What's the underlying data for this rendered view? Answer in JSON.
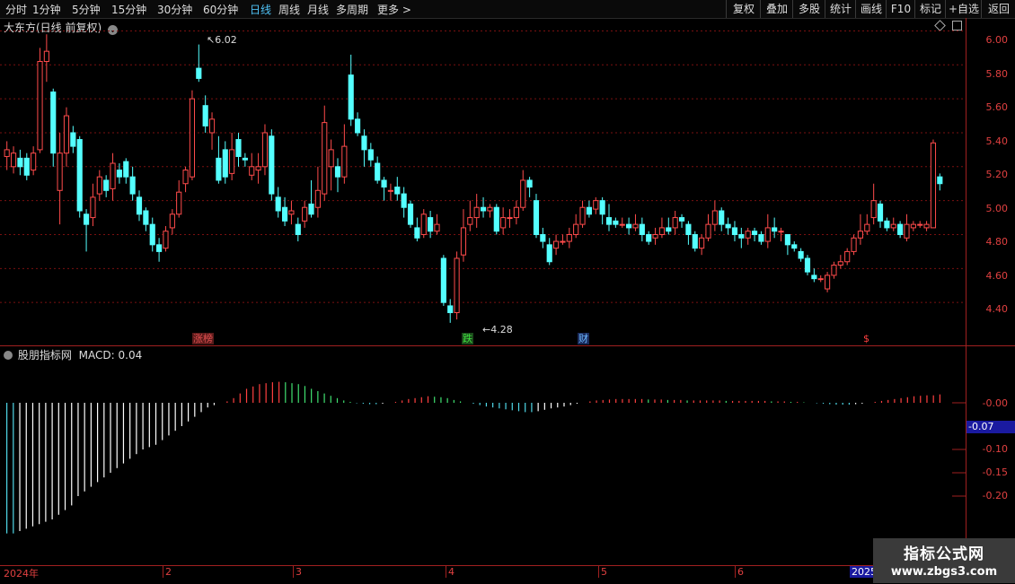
{
  "toolbar": {
    "timeframes": [
      "分时",
      "1分钟",
      "5分钟",
      "15分钟",
      "30分钟",
      "60分钟",
      "日线",
      "周线",
      "月线",
      "多周期",
      "更多 >"
    ],
    "active_timeframe": "日线",
    "right_buttons": [
      "复权",
      "叠加",
      "多股",
      "统计",
      "画线",
      "F10",
      "标记",
      "+自选",
      "返回"
    ]
  },
  "main_chart": {
    "title": "大东方(日线 前复权)",
    "y_ticks": [
      "6.00",
      "5.80",
      "5.60",
      "5.40",
      "5.20",
      "5.00",
      "4.80",
      "4.60",
      "4.40"
    ],
    "high_label": "6.02",
    "low_label": "4.28",
    "badges": [
      {
        "text": "涨榜",
        "color": "#e05050",
        "bg": "#5a1a1a"
      },
      {
        "text": "跌",
        "color": "#40e040",
        "bg": "#1a4a1a"
      },
      {
        "text": "财",
        "color": "#6bb8ff",
        "bg": "#1a2a5a"
      },
      {
        "text": "$",
        "color": "#ff4040",
        "bg": "#000000"
      }
    ]
  },
  "indicator": {
    "title": "股朋指标网",
    "macd_label": "MACD: 0.04",
    "y_ticks": [
      "-0.00",
      "-0.10",
      "-0.15",
      "-0.20"
    ],
    "current_value": "-0.07"
  },
  "date_axis": [
    "2024年",
    "2",
    "3",
    "4",
    "5",
    "6",
    "2025"
  ],
  "watermark": {
    "line1": "指标公式网",
    "line2": "www.zbgs3.com"
  },
  "chart_data": [
    {
      "type": "candlestick",
      "title": "大东方(日线 前复权)",
      "ylim": [
        4.2,
        6.05
      ],
      "candles": [
        [
          5.26,
          5.3,
          5.18,
          5.35
        ],
        [
          5.2,
          5.28,
          5.16,
          5.32
        ],
        [
          5.25,
          5.2,
          5.15,
          5.3
        ],
        [
          5.25,
          5.15,
          5.12,
          5.28
        ],
        [
          5.18,
          5.28,
          5.15,
          5.32
        ],
        [
          5.3,
          5.82,
          5.28,
          5.9
        ],
        [
          5.82,
          5.88,
          5.7,
          5.98
        ],
        [
          5.64,
          5.28,
          5.2,
          5.66
        ],
        [
          5.06,
          5.28,
          4.86,
          5.4
        ],
        [
          5.28,
          5.5,
          5.2,
          5.55
        ],
        [
          5.4,
          5.32,
          5.28,
          5.44
        ],
        [
          5.36,
          4.94,
          4.9,
          5.38
        ],
        [
          4.92,
          4.86,
          4.7,
          4.95
        ],
        [
          4.9,
          5.02,
          4.85,
          5.1
        ],
        [
          5.04,
          5.14,
          5.0,
          5.18
        ],
        [
          5.12,
          5.06,
          5.02,
          5.15
        ],
        [
          5.07,
          5.22,
          5.0,
          5.28
        ],
        [
          5.18,
          5.14,
          5.1,
          5.22
        ],
        [
          5.23,
          5.14,
          5.1,
          5.25
        ],
        [
          5.14,
          5.04,
          5.0,
          5.2
        ],
        [
          5.02,
          4.92,
          4.88,
          5.06
        ],
        [
          4.94,
          4.86,
          4.82,
          4.96
        ],
        [
          4.86,
          4.74,
          4.7,
          4.9
        ],
        [
          4.74,
          4.7,
          4.64,
          4.78
        ],
        [
          4.72,
          4.82,
          4.7,
          4.85
        ],
        [
          4.84,
          4.92,
          4.8,
          4.95
        ],
        [
          4.92,
          5.05,
          4.9,
          5.12
        ],
        [
          5.1,
          5.18,
          5.05,
          5.2
        ],
        [
          5.14,
          5.6,
          5.12,
          5.65
        ],
        [
          5.78,
          5.72,
          5.7,
          5.92
        ],
        [
          5.56,
          5.44,
          5.4,
          5.62
        ],
        [
          5.4,
          5.48,
          5.3,
          5.52
        ],
        [
          5.25,
          5.12,
          5.1,
          5.38
        ],
        [
          5.3,
          5.14,
          5.1,
          5.35
        ],
        [
          5.16,
          5.3,
          5.12,
          5.4
        ],
        [
          5.36,
          5.26,
          5.2,
          5.4
        ],
        [
          5.25,
          5.24,
          5.2,
          5.28
        ],
        [
          5.15,
          5.2,
          5.12,
          5.28
        ],
        [
          5.18,
          5.2,
          5.1,
          5.28
        ],
        [
          5.2,
          5.4,
          5.15,
          5.45
        ],
        [
          5.38,
          5.04,
          5.0,
          5.42
        ],
        [
          5.02,
          4.94,
          4.9,
          5.08
        ],
        [
          4.96,
          4.88,
          4.85,
          5.02
        ],
        [
          4.92,
          4.94,
          4.86,
          5.0
        ],
        [
          4.86,
          4.8,
          4.76,
          4.9
        ],
        [
          4.88,
          4.96,
          4.84,
          5.0
        ],
        [
          4.98,
          4.92,
          4.9,
          5.12
        ],
        [
          4.96,
          5.06,
          4.9,
          5.2
        ],
        [
          5.04,
          5.46,
          5.0,
          5.56
        ],
        [
          5.2,
          5.3,
          5.06,
          5.36
        ],
        [
          5.2,
          5.14,
          5.05,
          5.25
        ],
        [
          5.14,
          5.32,
          5.1,
          5.45
        ],
        [
          5.74,
          5.48,
          5.44,
          5.86
        ],
        [
          5.48,
          5.4,
          5.38,
          5.52
        ],
        [
          5.38,
          5.3,
          5.2,
          5.42
        ],
        [
          5.3,
          5.24,
          5.2,
          5.34
        ],
        [
          5.22,
          5.12,
          5.1,
          5.26
        ],
        [
          5.12,
          5.08,
          5.0,
          5.14
        ],
        [
          5.06,
          5.06,
          5.0,
          5.1
        ],
        [
          5.08,
          5.04,
          5.0,
          5.14
        ],
        [
          5.04,
          4.96,
          4.9,
          5.08
        ],
        [
          4.98,
          4.86,
          4.84,
          5.0
        ],
        [
          4.84,
          4.78,
          4.76,
          4.9
        ],
        [
          4.8,
          4.92,
          4.78,
          4.95
        ],
        [
          4.9,
          4.82,
          4.78,
          4.94
        ],
        [
          4.82,
          4.86,
          4.8,
          4.92
        ],
        [
          4.66,
          4.4,
          4.38,
          4.68
        ],
        [
          4.38,
          4.34,
          4.28,
          4.42
        ],
        [
          4.34,
          4.66,
          4.3,
          4.7
        ],
        [
          4.68,
          4.84,
          4.64,
          4.95
        ],
        [
          4.86,
          4.9,
          4.82,
          5.0
        ],
        [
          4.9,
          4.96,
          4.84,
          5.04
        ],
        [
          4.96,
          4.94,
          4.9,
          5.02
        ],
        [
          4.94,
          4.96,
          4.9,
          4.98
        ],
        [
          4.96,
          4.82,
          4.8,
          4.98
        ],
        [
          4.84,
          4.9,
          4.8,
          4.96
        ],
        [
          4.9,
          4.9,
          4.84,
          4.95
        ],
        [
          4.9,
          4.96,
          4.86,
          5.0
        ],
        [
          4.96,
          5.12,
          4.94,
          5.18
        ],
        [
          5.12,
          5.08,
          5.02,
          5.14
        ],
        [
          5.0,
          4.8,
          4.78,
          5.04
        ],
        [
          4.8,
          4.76,
          4.72,
          4.84
        ],
        [
          4.74,
          4.64,
          4.62,
          4.78
        ],
        [
          4.72,
          4.76,
          4.68,
          4.8
        ],
        [
          4.76,
          4.76,
          4.74,
          4.8
        ],
        [
          4.76,
          4.8,
          4.72,
          4.84
        ],
        [
          4.8,
          4.86,
          4.78,
          4.92
        ],
        [
          4.86,
          4.96,
          4.84,
          5.0
        ],
        [
          4.96,
          4.92,
          4.9,
          5.0
        ],
        [
          4.95,
          5.0,
          4.92,
          5.02
        ],
        [
          5.0,
          4.92,
          4.86,
          5.02
        ],
        [
          4.9,
          4.86,
          4.82,
          4.98
        ],
        [
          4.88,
          4.86,
          4.84,
          4.9
        ],
        [
          4.86,
          4.86,
          4.84,
          4.9
        ],
        [
          4.86,
          4.84,
          4.8,
          4.9
        ],
        [
          4.84,
          4.86,
          4.82,
          4.92
        ],
        [
          4.86,
          4.8,
          4.76,
          4.9
        ],
        [
          4.8,
          4.76,
          4.74,
          4.82
        ],
        [
          4.78,
          4.8,
          4.74,
          4.84
        ],
        [
          4.8,
          4.84,
          4.78,
          4.9
        ],
        [
          4.84,
          4.82,
          4.8,
          4.9
        ],
        [
          4.84,
          4.9,
          4.8,
          4.94
        ],
        [
          4.9,
          4.88,
          4.84,
          4.92
        ],
        [
          4.86,
          4.8,
          4.74,
          4.88
        ],
        [
          4.8,
          4.72,
          4.7,
          4.82
        ],
        [
          4.72,
          4.78,
          4.68,
          4.8
        ],
        [
          4.78,
          4.86,
          4.76,
          4.92
        ],
        [
          4.86,
          4.94,
          4.82,
          5.0
        ],
        [
          4.94,
          4.86,
          4.82,
          4.96
        ],
        [
          4.86,
          4.84,
          4.8,
          4.9
        ],
        [
          4.84,
          4.8,
          4.76,
          4.88
        ],
        [
          4.8,
          4.78,
          4.72,
          4.84
        ],
        [
          4.78,
          4.82,
          4.74,
          4.84
        ],
        [
          4.82,
          4.8,
          4.76,
          4.84
        ],
        [
          4.8,
          4.76,
          4.74,
          4.82
        ],
        [
          4.76,
          4.84,
          4.72,
          4.92
        ],
        [
          4.84,
          4.82,
          4.78,
          4.9
        ],
        [
          4.82,
          4.82,
          4.76,
          4.84
        ],
        [
          4.8,
          4.74,
          4.68,
          4.8
        ],
        [
          4.74,
          4.72,
          4.7,
          4.76
        ],
        [
          4.7,
          4.66,
          4.64,
          4.72
        ],
        [
          4.66,
          4.58,
          4.56,
          4.68
        ],
        [
          4.56,
          4.54,
          4.52,
          4.6
        ],
        [
          4.54,
          4.54,
          4.52,
          4.56
        ],
        [
          4.48,
          4.56,
          4.46,
          4.58
        ],
        [
          4.56,
          4.62,
          4.54,
          4.64
        ],
        [
          4.62,
          4.64,
          4.6,
          4.68
        ],
        [
          4.64,
          4.7,
          4.62,
          4.72
        ],
        [
          4.7,
          4.78,
          4.68,
          4.8
        ],
        [
          4.78,
          4.82,
          4.74,
          4.92
        ],
        [
          4.82,
          4.86,
          4.8,
          4.92
        ],
        [
          4.9,
          5.0,
          4.86,
          5.1
        ],
        [
          4.98,
          4.88,
          4.84,
          5.0
        ],
        [
          4.88,
          4.84,
          4.82,
          4.9
        ],
        [
          4.84,
          4.86,
          4.82,
          4.9
        ],
        [
          4.86,
          4.8,
          4.78,
          4.88
        ],
        [
          4.78,
          4.86,
          4.76,
          4.92
        ],
        [
          4.84,
          4.86,
          4.82,
          4.88
        ],
        [
          4.86,
          4.86,
          4.84,
          4.88
        ],
        [
          4.84,
          4.86,
          4.82,
          4.88
        ],
        [
          4.84,
          5.34,
          4.84,
          5.36
        ],
        [
          5.14,
          5.1,
          5.06,
          5.16
        ]
      ]
    },
    {
      "type": "bar",
      "title": "MACD",
      "ylim": [
        -0.27,
        0.04
      ],
      "values": [
        -0.28,
        -0.28,
        -0.275,
        -0.27,
        -0.265,
        -0.26,
        -0.255,
        -0.25,
        -0.24,
        -0.23,
        -0.22,
        -0.2,
        -0.19,
        -0.18,
        -0.17,
        -0.16,
        -0.15,
        -0.14,
        -0.13,
        -0.12,
        -0.11,
        -0.1,
        -0.095,
        -0.09,
        -0.08,
        -0.07,
        -0.06,
        -0.05,
        -0.04,
        -0.03,
        -0.02,
        -0.01,
        -0.005,
        0.0,
        0.003,
        0.01,
        0.02,
        0.03,
        0.035,
        0.04,
        0.042,
        0.044,
        0.045,
        0.044,
        0.042,
        0.04,
        0.036,
        0.03,
        0.025,
        0.02,
        0.015,
        0.01,
        0.005,
        0.002,
        -0.001,
        -0.002,
        -0.003,
        -0.003,
        -0.002,
        0.0,
        0.002,
        0.005,
        0.008,
        0.01,
        0.012,
        0.014,
        0.013,
        0.012,
        0.01,
        0.006,
        0.003,
        0.0,
        -0.002,
        -0.005,
        -0.008,
        -0.01,
        -0.012,
        -0.014,
        -0.016,
        -0.018,
        -0.02,
        -0.02,
        -0.018,
        -0.015,
        -0.012,
        -0.01,
        -0.008,
        -0.005,
        -0.002,
        0.0,
        0.003,
        0.005,
        0.006,
        0.007,
        0.008,
        0.008,
        0.008,
        0.008,
        0.008,
        0.007,
        0.007,
        0.007,
        0.006,
        0.006,
        0.006,
        0.005,
        0.005,
        0.005,
        0.005,
        0.005,
        0.005,
        0.004,
        0.004,
        0.004,
        0.004,
        0.004,
        0.004,
        0.004,
        0.003,
        0.003,
        0.003,
        0.002,
        0.002,
        0.001,
        0.0,
        -0.001,
        -0.002,
        -0.003,
        -0.004,
        -0.004,
        -0.004,
        -0.003,
        -0.002,
        0.0,
        0.002,
        0.004,
        0.006,
        0.008,
        0.01,
        0.012,
        0.014,
        0.015,
        0.016,
        0.016,
        0.018
      ]
    }
  ]
}
